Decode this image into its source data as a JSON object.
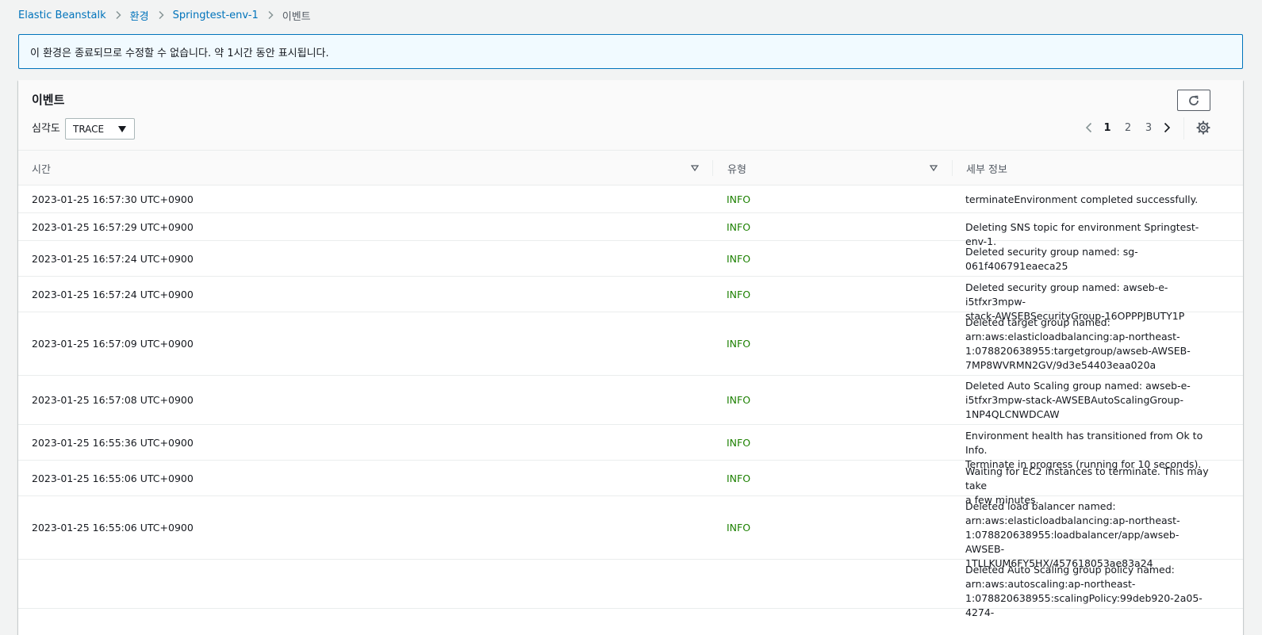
{
  "breadcrumb": {
    "items": [
      "Elastic Beanstalk",
      "환경",
      "Springtest-env-1"
    ],
    "current": "이벤트"
  },
  "flash": {
    "message": "이 환경은 종료되므로 수정할 수 없습니다. 약 1시간 동안 표시됩니다."
  },
  "events": {
    "title": "이벤트",
    "severity_label": "심각도",
    "severity_value": "TRACE",
    "pages": [
      "1",
      "2",
      "3"
    ],
    "current_page": "1",
    "columns": {
      "time": "시간",
      "type": "유형",
      "details": "세부 정보"
    },
    "rows": [
      {
        "time": "2023-01-25 16:57:30 UTC+0900",
        "type": "INFO",
        "details": [
          "terminateEnvironment completed successfully."
        ]
      },
      {
        "time": "2023-01-25 16:57:29 UTC+0900",
        "type": "INFO",
        "details": [
          "Deleting SNS topic for environment Springtest-env-1."
        ]
      },
      {
        "time": "2023-01-25 16:57:24 UTC+0900",
        "type": "INFO",
        "details": [
          "Deleted security group named: sg-",
          "061f406791eaeca25"
        ]
      },
      {
        "time": "2023-01-25 16:57:24 UTC+0900",
        "type": "INFO",
        "details": [
          "Deleted security group named: awseb-e-i5tfxr3mpw-",
          "stack-AWSEBSecurityGroup-16OPPPJBUTY1P"
        ]
      },
      {
        "time": "2023-01-25 16:57:09 UTC+0900",
        "type": "INFO",
        "details": [
          "Deleted target group named:",
          "arn:aws:elasticloadbalancing:ap-northeast-",
          "1:078820638955:targetgroup/awseb-AWSEB-",
          "7MP8WVRMN2GV/9d3e54403eaa020a"
        ]
      },
      {
        "time": "2023-01-25 16:57:08 UTC+0900",
        "type": "INFO",
        "details": [
          "Deleted Auto Scaling group named: awseb-e-",
          "i5tfxr3mpw-stack-AWSEBAutoScalingGroup-",
          "1NP4QLCNWDCAW"
        ]
      },
      {
        "time": "2023-01-25 16:55:36 UTC+0900",
        "type": "INFO",
        "details": [
          "Environment health has transitioned from Ok to Info.",
          "Terminate in progress (running for 10 seconds)."
        ]
      },
      {
        "time": "2023-01-25 16:55:06 UTC+0900",
        "type": "INFO",
        "details": [
          "Waiting for EC2 instances to terminate. This may take",
          "a few minutes."
        ]
      },
      {
        "time": "2023-01-25 16:55:06 UTC+0900",
        "type": "INFO",
        "details": [
          "Deleted load balancer named:",
          "arn:aws:elasticloadbalancing:ap-northeast-",
          "1:078820638955:loadbalancer/app/awseb-AWSEB-",
          "1TLLKUM6FY5HX/457618053ae83a24"
        ]
      },
      {
        "time": "",
        "type": "",
        "details": [
          "Deleted Auto Scaling group policy named:",
          "arn:aws:autoscaling:ap-northeast-",
          "1:078820638955:scalingPolicy:99deb920-2a05-4274-"
        ]
      }
    ]
  },
  "colors": {
    "link": "#0073bb",
    "info": "#1d8102",
    "flash_border": "#0073bb"
  },
  "icons": [
    "chevron-right-icon",
    "caret-down-icon",
    "refresh-icon",
    "chevron-left-icon",
    "settings-gear-icon",
    "sort-icon"
  ]
}
